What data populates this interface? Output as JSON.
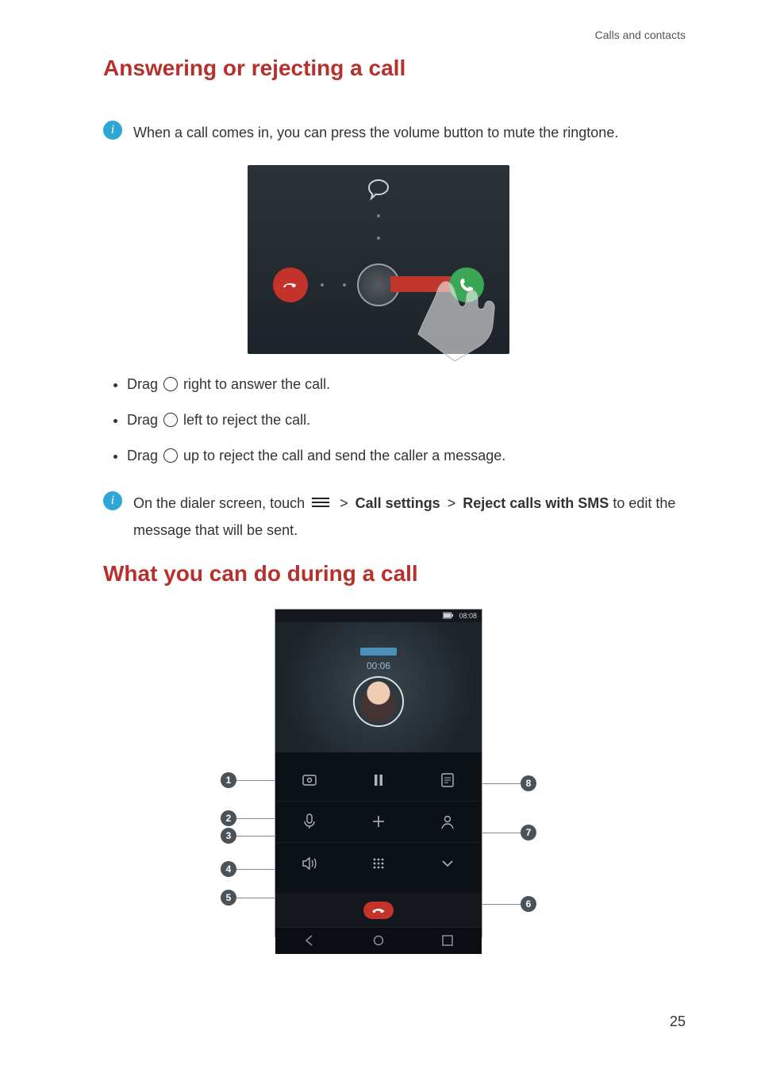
{
  "breadcrumb": "Calls and contacts",
  "heading1": "Answering or rejecting a call",
  "tip1": "When a call comes in, you can press the volume button to mute the ringtone.",
  "bullets": {
    "b1_pre": "Drag ",
    "b1_post": " right to answer the call.",
    "b2_pre": "Drag ",
    "b2_post": " left to reject the call.",
    "b3_pre": "Drag ",
    "b3_post": " up to reject the call and send the caller a message."
  },
  "tip2_pre": "On the dialer screen, touch ",
  "tip2_mid1": "Call settings",
  "tip2_mid2": "Reject calls with SMS",
  "tip2_post": " to edit the message that will be sent.",
  "tip2_gt": ">",
  "heading2": "What you can do during a call",
  "status_time": "08:08",
  "call_timer": "00:06",
  "chart_data": {
    "type": "table",
    "title": "In-call screen callouts",
    "callouts_left": [
      1,
      2,
      3,
      4,
      5
    ],
    "callouts_right": [
      8,
      7,
      6
    ]
  },
  "page_number": "25"
}
